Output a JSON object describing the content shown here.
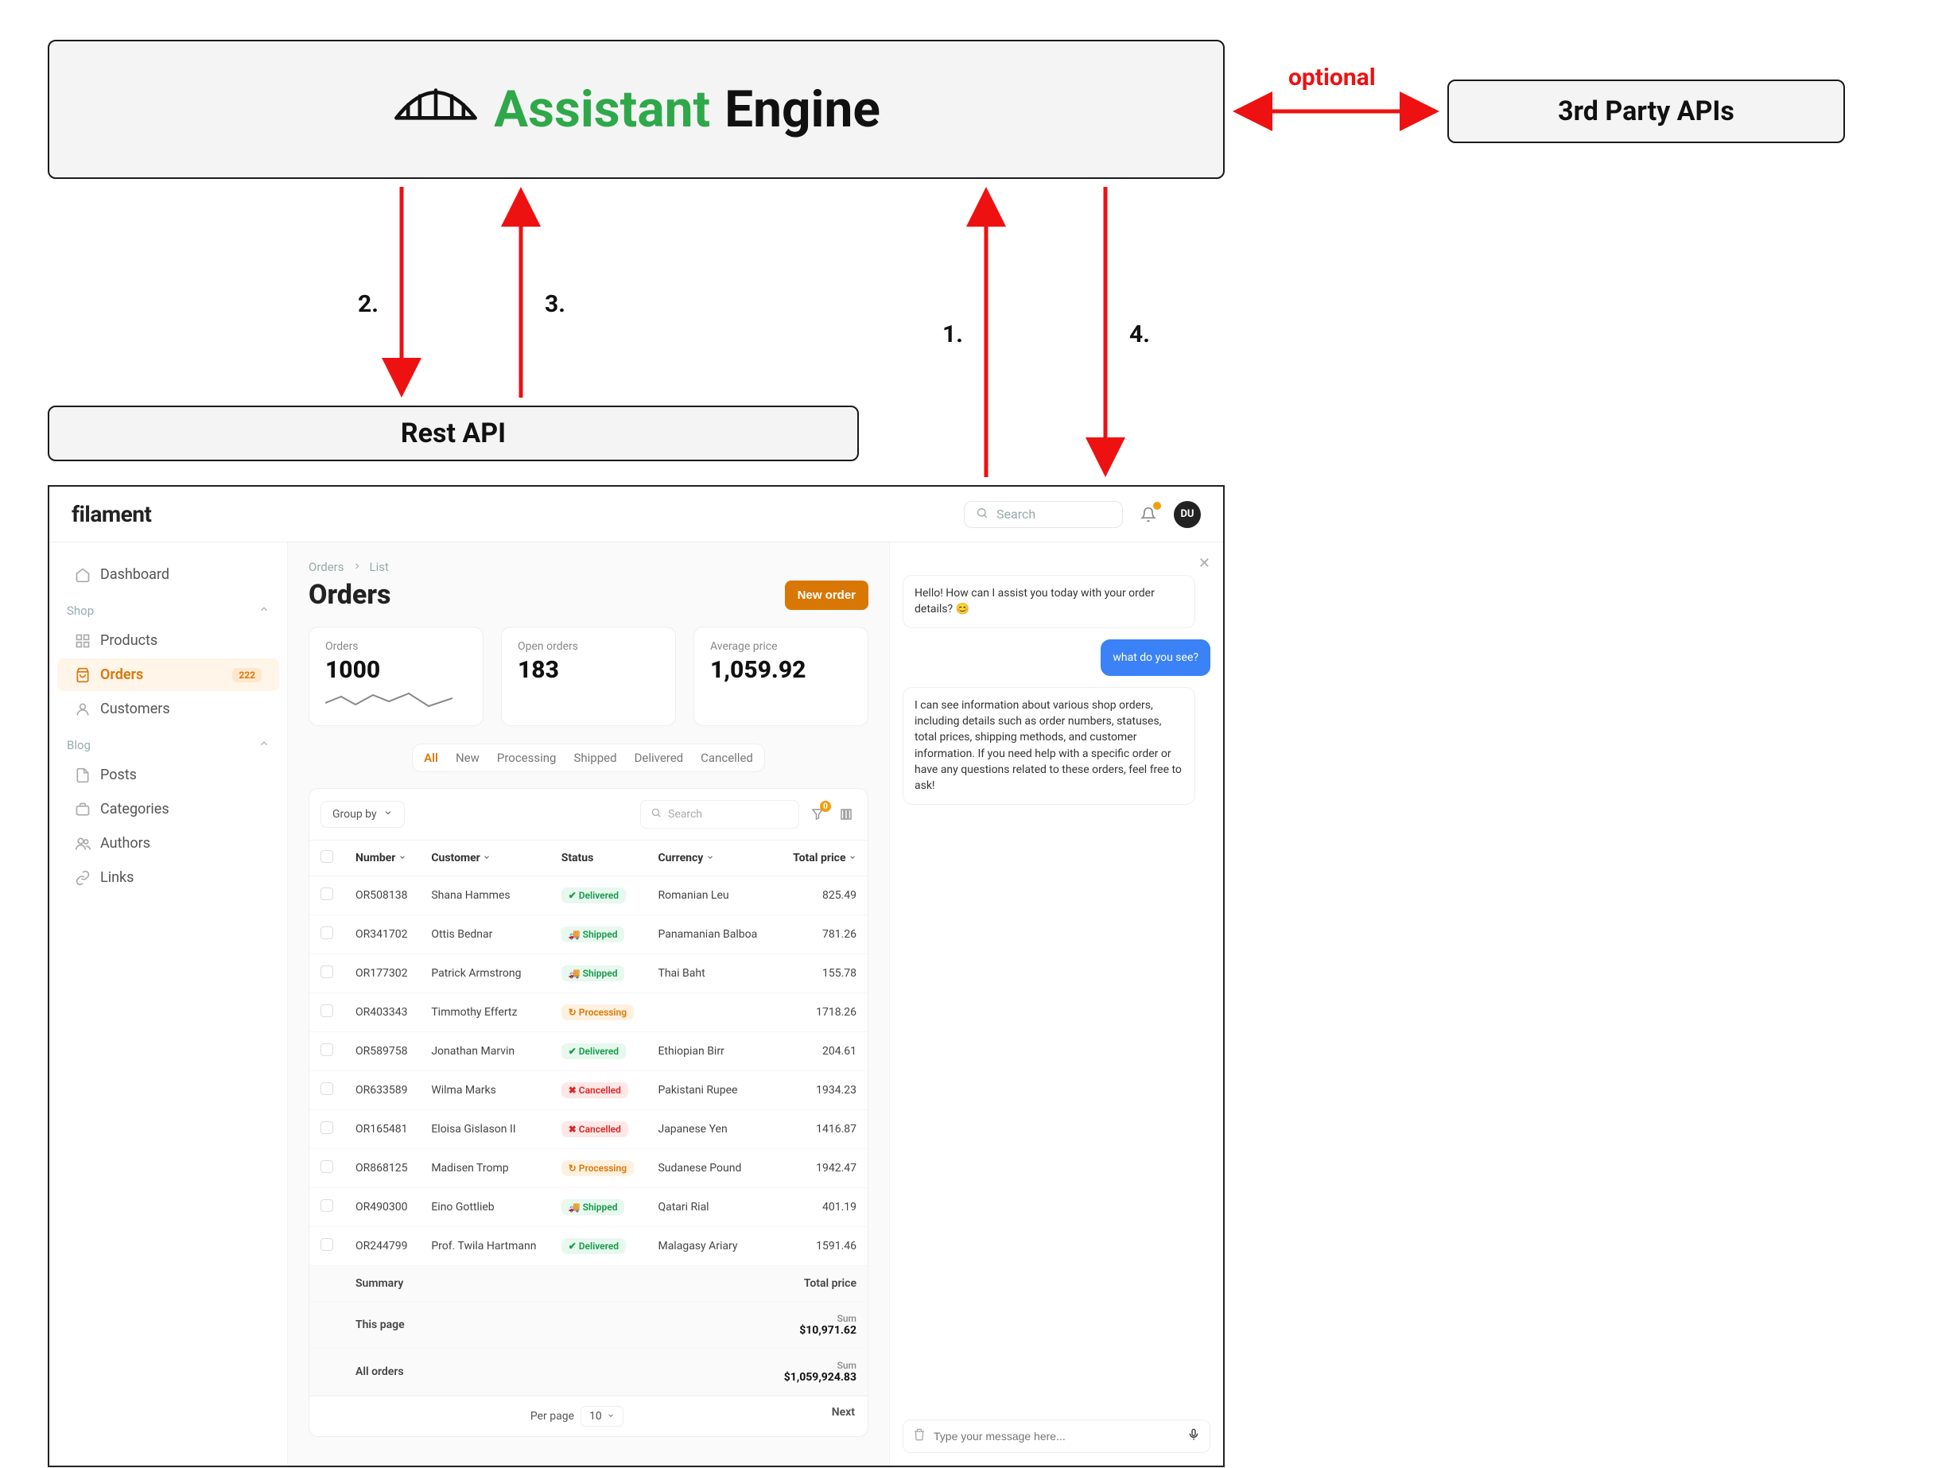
{
  "diagram": {
    "assistant_engine": {
      "word1": "Assistant",
      "word2": "Engine"
    },
    "third_party": "3rd Party APIs",
    "rest_api": "Rest API",
    "optional": "optional",
    "labels": {
      "l1": "1.",
      "l2": "2.",
      "l3": "3.",
      "l4": "4."
    }
  },
  "app": {
    "brand": "filament",
    "search_placeholder": "Search",
    "avatar_initials": "DU",
    "sidebar": {
      "dashboard": "Dashboard",
      "shop_section": "Shop",
      "products": "Products",
      "orders": "Orders",
      "orders_badge": "222",
      "customers": "Customers",
      "blog_section": "Blog",
      "posts": "Posts",
      "categories": "Categories",
      "authors": "Authors",
      "links": "Links"
    },
    "crumbs": {
      "c1": "Orders",
      "c2": "List"
    },
    "page_title": "Orders",
    "new_order": "New order",
    "stats": {
      "orders_label": "Orders",
      "orders_value": "1000",
      "open_label": "Open orders",
      "open_value": "183",
      "avg_label": "Average price",
      "avg_value": "1,059.92"
    },
    "tabs": {
      "all": "All",
      "new": "New",
      "processing": "Processing",
      "shipped": "Shipped",
      "delivered": "Delivered",
      "cancelled": "Cancelled"
    },
    "table": {
      "group_by": "Group by",
      "search_placeholder": "Search",
      "filter_count": "0",
      "columns": {
        "number": "Number",
        "customer": "Customer",
        "status": "Status",
        "currency": "Currency",
        "total": "Total price"
      },
      "rows": [
        {
          "number": "OR508138",
          "customer": "Shana Hammes",
          "status": "Delivered",
          "status_class": "st-delivered",
          "currency": "Romanian Leu",
          "total": "825.49"
        },
        {
          "number": "OR341702",
          "customer": "Ottis Bednar",
          "status": "Shipped",
          "status_class": "st-shipped",
          "currency": "Panamanian Balboa",
          "total": "781.26"
        },
        {
          "number": "OR177302",
          "customer": "Patrick Armstrong",
          "status": "Shipped",
          "status_class": "st-shipped",
          "currency": "Thai Baht",
          "total": "155.78"
        },
        {
          "number": "OR403343",
          "customer": "Timmothy Effertz",
          "status": "Processing",
          "status_class": "st-processing",
          "currency": "",
          "total": "1718.26"
        },
        {
          "number": "OR589758",
          "customer": "Jonathan Marvin",
          "status": "Delivered",
          "status_class": "st-delivered",
          "currency": "Ethiopian Birr",
          "total": "204.61"
        },
        {
          "number": "OR633589",
          "customer": "Wilma Marks",
          "status": "Cancelled",
          "status_class": "st-cancelled",
          "currency": "Pakistani Rupee",
          "total": "1934.23"
        },
        {
          "number": "OR165481",
          "customer": "Eloisa Gislason II",
          "status": "Cancelled",
          "status_class": "st-cancelled",
          "currency": "Japanese Yen",
          "total": "1416.87"
        },
        {
          "number": "OR868125",
          "customer": "Madisen Tromp",
          "status": "Processing",
          "status_class": "st-processing",
          "currency": "Sudanese Pound",
          "total": "1942.47"
        },
        {
          "number": "OR490300",
          "customer": "Eino Gottlieb",
          "status": "Shipped",
          "status_class": "st-shipped",
          "currency": "Qatari Rial",
          "total": "401.19"
        },
        {
          "number": "OR244799",
          "customer": "Prof. Twila Hartmann",
          "status": "Delivered",
          "status_class": "st-delivered",
          "currency": "Malagasy Ariary",
          "total": "1591.46"
        }
      ],
      "summary_label": "Summary",
      "summary_total_label": "Total price",
      "this_page_label": "This page",
      "this_page_sum_label": "Sum",
      "this_page_sum": "$10,971.62",
      "all_orders_label": "All orders",
      "all_sum_label": "Sum",
      "all_sum": "$1,059,924.83",
      "per_page_label": "Per page",
      "per_page_value": "10",
      "next_label": "Next"
    },
    "chat": {
      "greet": "Hello! How can I assist you today with your order details? 😊",
      "user_msg": "what do you see?",
      "reply": "I can see information about various shop orders, including details such as order numbers, statuses, total prices, shipping methods, and customer information. If you need help with a specific order or have any questions related to these orders, feel free to ask!",
      "input_placeholder": "Type your message here..."
    }
  }
}
